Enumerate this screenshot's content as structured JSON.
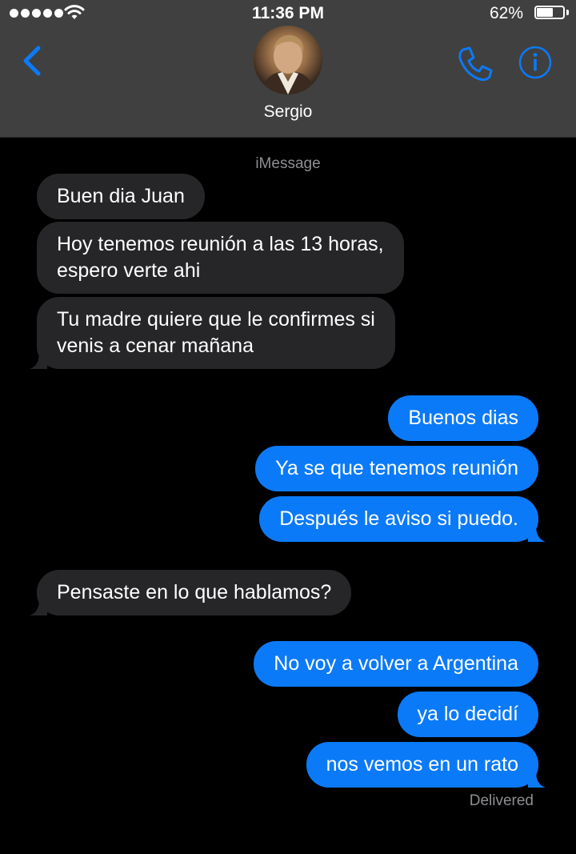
{
  "status_bar": {
    "time": "11:36 PM",
    "battery_percent": "62%",
    "battery_level": 0.62,
    "signal_bars": 5
  },
  "header": {
    "contact_name": "Sergio"
  },
  "conversation": {
    "service_label": "iMessage",
    "messages": [
      {
        "direction": "incoming",
        "lines": [
          "Buen dia Juan"
        ]
      },
      {
        "direction": "incoming",
        "lines": [
          "Hoy tenemos reunión a las 13 horas,",
          "espero verte ahi"
        ]
      },
      {
        "direction": "incoming",
        "lines": [
          "Tu madre quiere que le confirmes si",
          "venis a cenar mañana"
        ]
      },
      {
        "direction": "outgoing",
        "lines": [
          "Buenos dias"
        ]
      },
      {
        "direction": "outgoing",
        "lines": [
          "Ya se que tenemos reunión"
        ]
      },
      {
        "direction": "outgoing",
        "lines": [
          "Después le aviso si puedo."
        ]
      },
      {
        "direction": "incoming",
        "lines": [
          "Pensaste en lo que hablamos?"
        ]
      },
      {
        "direction": "outgoing",
        "lines": [
          "No voy a volver a Argentina"
        ]
      },
      {
        "direction": "outgoing",
        "lines": [
          "ya lo decidí"
        ]
      },
      {
        "direction": "outgoing",
        "lines": [
          "nos vemos en un rato"
        ]
      }
    ],
    "delivery_status": "Delivered"
  },
  "colors": {
    "accent": "#0b7af8",
    "incoming_bubble": "#262628",
    "header_bg": "#404040",
    "meta_text": "#8e8e93"
  },
  "icons": {
    "back": "chevron-left-icon",
    "call": "phone-icon",
    "info": "info-icon",
    "wifi": "wifi-icon",
    "battery": "battery-icon"
  }
}
